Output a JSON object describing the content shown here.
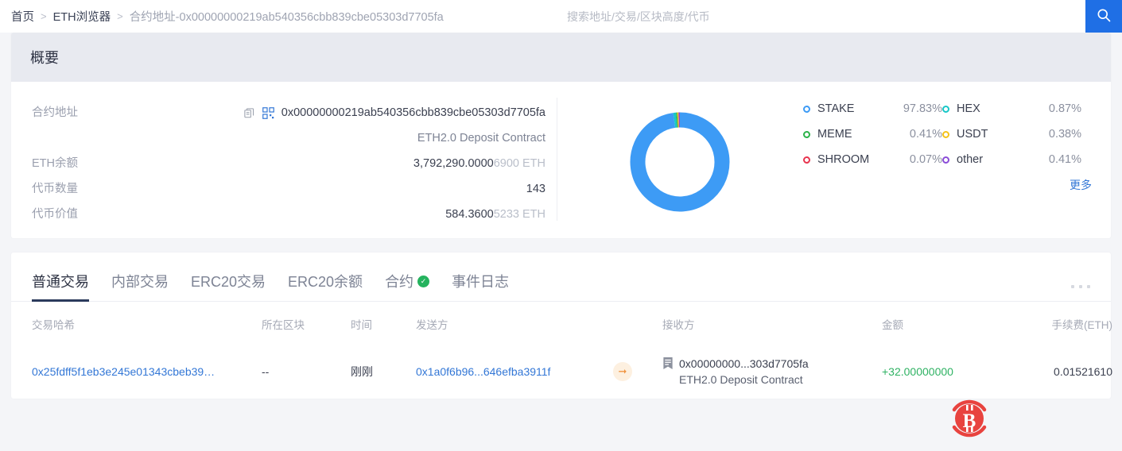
{
  "breadcrumb": {
    "home": "首页",
    "explorer": "ETH浏览器",
    "current": "合约地址-0x00000000219ab540356cbb839cbe05303d7705fa",
    "separator": ">"
  },
  "search": {
    "placeholder": "搜索地址/交易/区块高度/代币",
    "value": "",
    "icon": "search-icon"
  },
  "summary": {
    "title": "概要",
    "rows": [
      {
        "label": "合约地址",
        "value": "0x00000000219ab540356cbb839cbe05303d7705fa"
      },
      {
        "label": "",
        "value": "ETH2.0 Deposit Contract"
      },
      {
        "label": "ETH余额",
        "value_main": "3,792,290.0000",
        "value_dim": "6900 ETH"
      },
      {
        "label": "代币数量",
        "value": "143"
      },
      {
        "label": "代币价值",
        "value_main": "584.3600",
        "value_dim": "5233 ETH"
      }
    ],
    "copy_icon": "copy-icon",
    "qr_icon": "qrcode-icon",
    "more_label": "更多"
  },
  "chart_data": {
    "type": "pie",
    "title": "",
    "categories": [
      "STAKE",
      "HEX",
      "MEME",
      "USDT",
      "SHROOM",
      "other"
    ],
    "values": [
      97.83,
      0.87,
      0.41,
      0.38,
      0.07,
      0.41
    ],
    "unit": "%",
    "colors": [
      "#3d9bf5",
      "#17c7c7",
      "#2cb34a",
      "#f5c318",
      "#e8344e",
      "#8a4bd8"
    ],
    "legend_position": "right",
    "donut": true,
    "inner_radius_ratio": 0.72,
    "labels": [
      "97.83%",
      "0.87%",
      "0.41%",
      "0.38%",
      "0.07%",
      "0.41%"
    ]
  },
  "tabs": [
    {
      "label": "普通交易",
      "active": true,
      "badge": ""
    },
    {
      "label": "内部交易",
      "active": false,
      "badge": ""
    },
    {
      "label": "ERC20交易",
      "active": false,
      "badge": ""
    },
    {
      "label": "ERC20余额",
      "active": false,
      "badge": ""
    },
    {
      "label": "合约",
      "active": false,
      "badge": "check"
    },
    {
      "label": "事件日志",
      "active": false,
      "badge": ""
    }
  ],
  "table": {
    "headers": [
      "交易哈希",
      "所在区块",
      "时间",
      "发送方",
      "",
      "接收方",
      "金额",
      "手续费(ETH)"
    ],
    "rows": [
      {
        "hash": "0x25fdff5f1eb3e245e01343cbeb39…",
        "block": "--",
        "time": "刚刚",
        "from": "0x1a0f6b96...646efba3911f",
        "to": "0x00000000...303d7705fa",
        "to_sub": "ETH2.0 Deposit Contract",
        "amount": "+32.00000000",
        "fee": "0.01521610"
      }
    ]
  },
  "watermark": {
    "icon": "bitcoin-logo",
    "color": "#e8433f"
  }
}
